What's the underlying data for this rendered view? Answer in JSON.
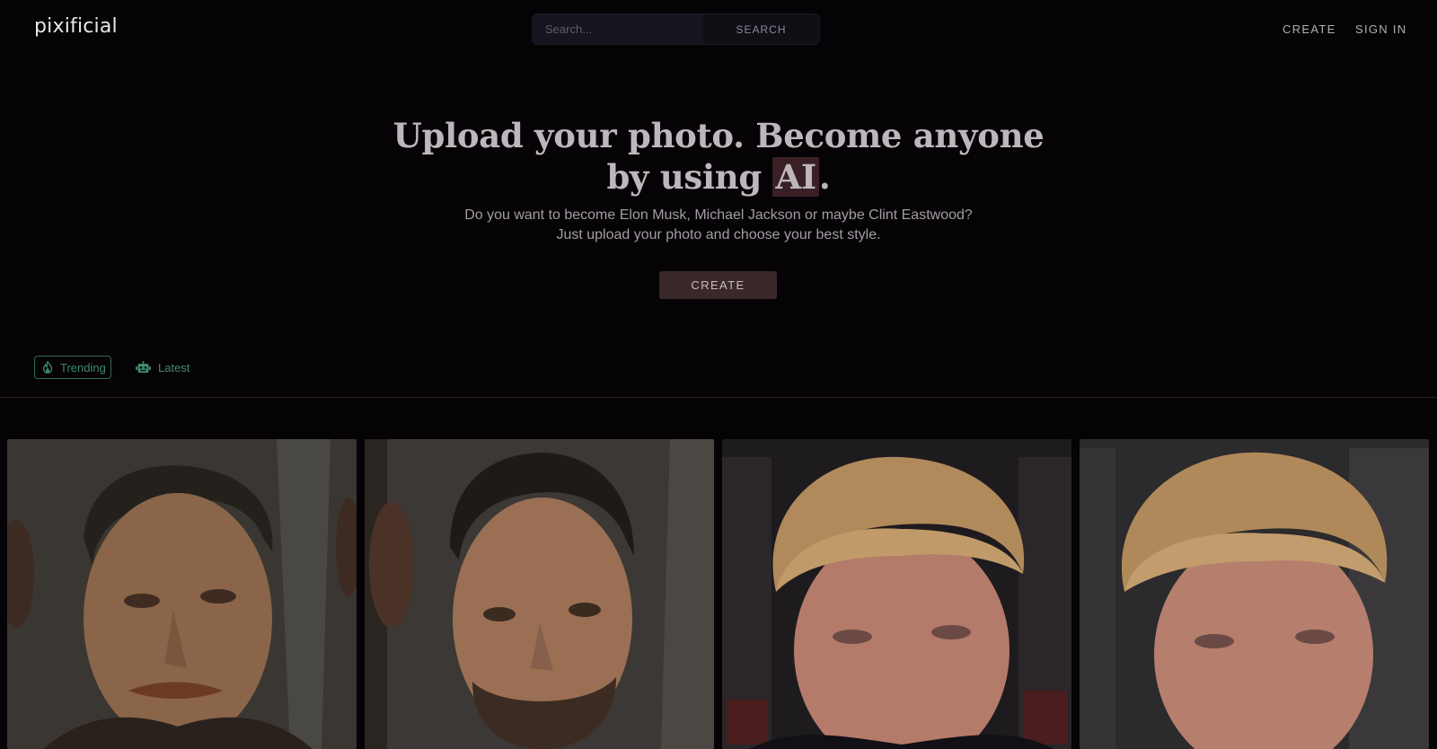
{
  "header": {
    "logo": "pixificial",
    "search": {
      "placeholder": "Search...",
      "button_label": "SEARCH"
    },
    "nav": {
      "create_label": "CREATE",
      "signin_label": "SIGN IN"
    }
  },
  "hero": {
    "title_part1": "Upload your photo. Become anyone",
    "title_part2": "by using ",
    "title_highlight": "AI",
    "title_end": ".",
    "subtitle_line1": "Do you want to become Elon Musk, Michael Jackson or maybe Clint Eastwood?",
    "subtitle_line2": "Just upload your photo and choose your best style.",
    "cta_label": "CREATE"
  },
  "tabs": [
    {
      "label": "Trending",
      "icon": "flame-icon",
      "active": true
    },
    {
      "label": "Latest",
      "icon": "robot-icon",
      "active": false
    }
  ],
  "colors": {
    "background": "#050305",
    "accent_green": "#3f8a68",
    "cta_bg": "#3b282b",
    "highlight_bg": "#3a2024"
  },
  "gallery": [
    {
      "subject": "portrait-man-mustache"
    },
    {
      "subject": "portrait-man-beard"
    },
    {
      "subject": "portrait-blonde-man-suit"
    },
    {
      "subject": "portrait-blonde-man-suit-2"
    }
  ]
}
